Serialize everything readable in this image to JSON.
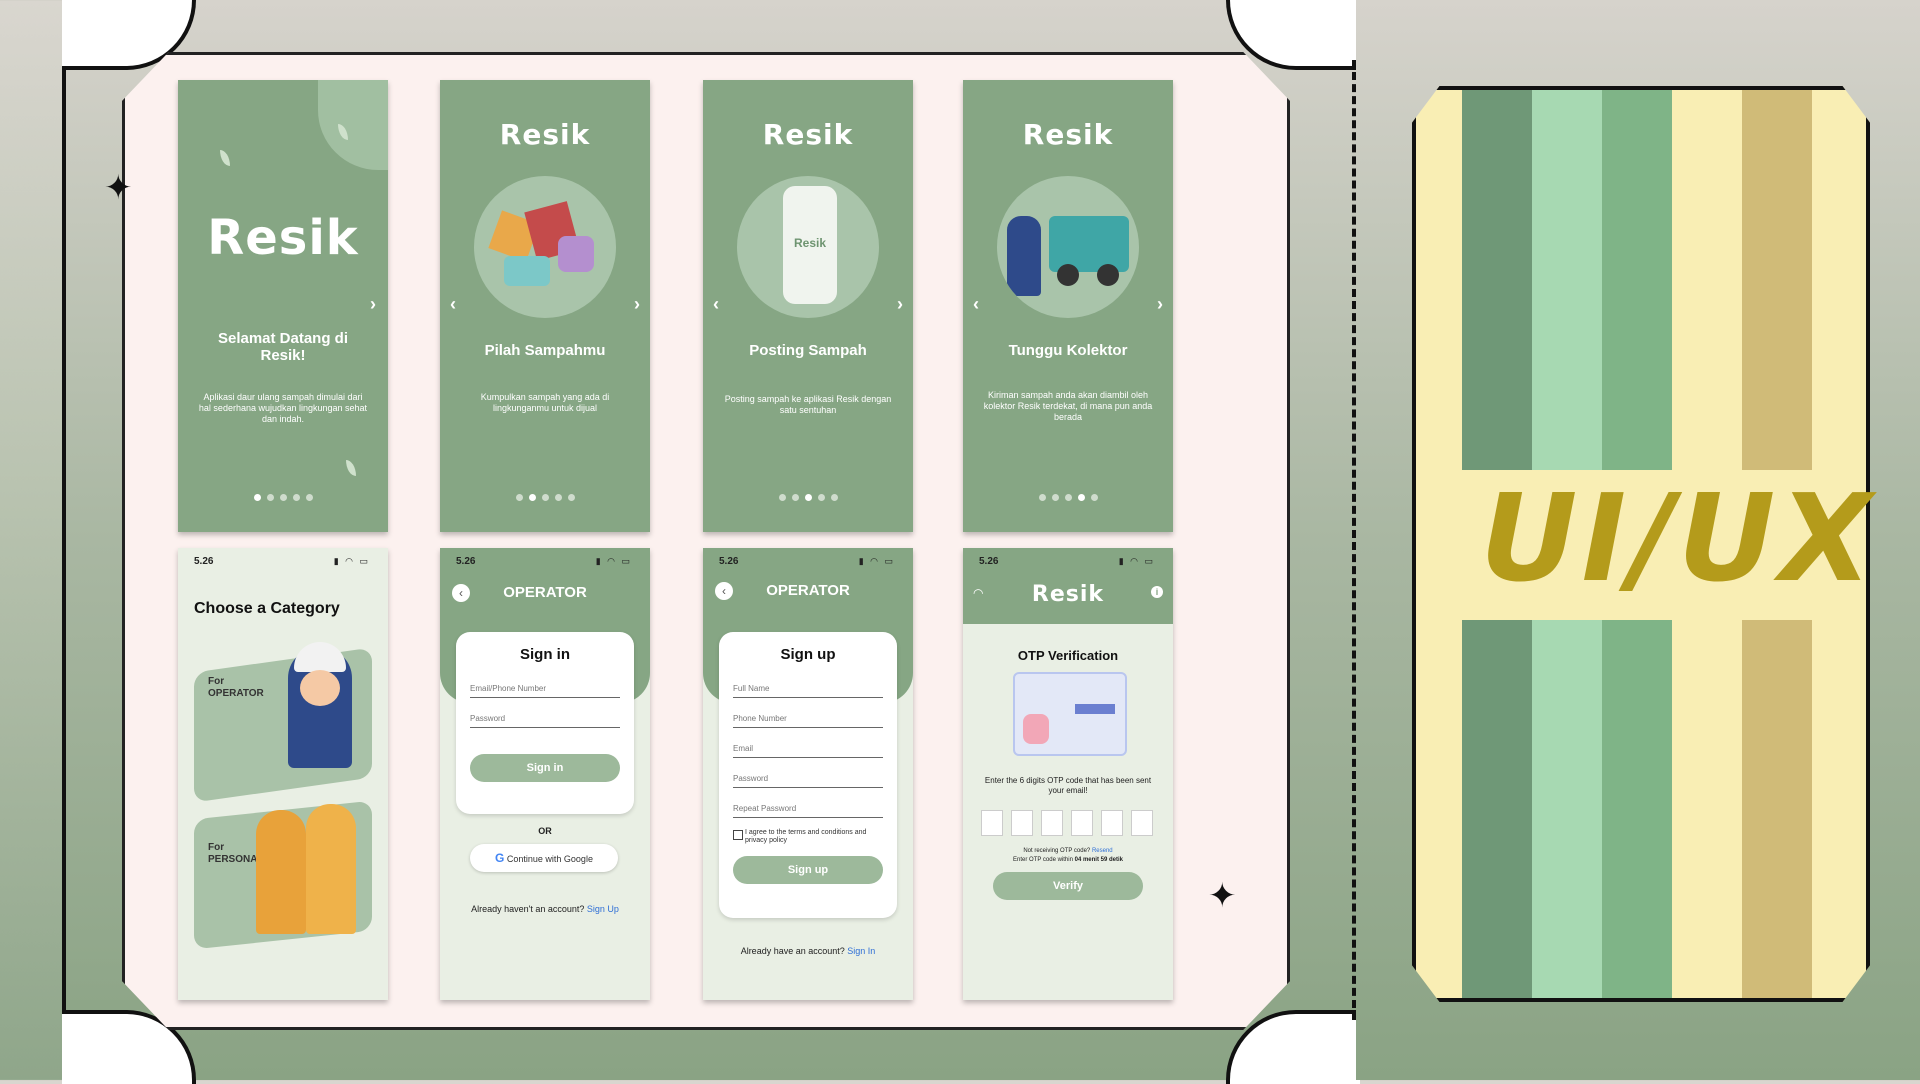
{
  "brand": {
    "logo": "Resik",
    "colors": {
      "primary": "#86a684",
      "button": "#9db99b",
      "accent_gold": "#b49b1b",
      "link": "#2f6fd6"
    }
  },
  "onboarding": [
    {
      "title": "Selamat Datang di Resik!",
      "desc": "Aplikasi daur ulang sampah dimulai dari hal sederhana wujudkan lingkungan sehat dan indah.",
      "active_dot": 1,
      "dots_total": 5
    },
    {
      "title": "Pilah Sampahmu",
      "desc": "Kumpulkan sampah yang ada di lingkunganmu untuk dijual",
      "active_dot": 2,
      "dots_total": 5
    },
    {
      "title": "Posting Sampah",
      "desc": "Posting sampah ke aplikasi Resik dengan satu sentuhan",
      "active_dot": 3,
      "dots_total": 5
    },
    {
      "title": "Tunggu Kolektor",
      "desc": "Kiriman sampah anda akan diambil oleh kolektor Resik terdekat, di mana pun anda berada",
      "active_dot": 4,
      "dots_total": 5
    }
  ],
  "status_bar": {
    "time": "5.26"
  },
  "category": {
    "heading": "Choose a Category",
    "operator_for": "For",
    "operator_label": "OPERATOR",
    "personal_for": "For",
    "personal_label": "PERSONAL"
  },
  "signin": {
    "header": "OPERATOR",
    "title": "Sign in",
    "email_placeholder": "Email/Phone Number",
    "password_placeholder": "Password",
    "button": "Sign in",
    "or": "OR",
    "google_button": "Continue with Google",
    "footer_text": "Already haven't an account?",
    "footer_link": "Sign Up"
  },
  "signup": {
    "header": "OPERATOR",
    "title": "Sign up",
    "fields": [
      "Full Name",
      "Phone Number",
      "Email",
      "Password",
      "Repeat Password"
    ],
    "terms": "I agree to the terms and conditions and privacy policy",
    "button": "Sign up",
    "footer_text": "Already have an account?",
    "footer_link": "Sign In"
  },
  "otp": {
    "title": "OTP Verification",
    "instruction": "Enter the 6 digits OTP code that has been sent your email!",
    "not_receiving": "Not receiving OTP code?",
    "resend": "Resend",
    "timer_text": "Enter OTP code within",
    "timer_value": "04 menit 59 detik",
    "button": "Verify"
  },
  "stub": {
    "label": "UI/UX",
    "stripe_colors": [
      "#6f9877",
      "#a7d9b2",
      "#7fb487",
      "#f9eeb4",
      "#d0bb78"
    ]
  }
}
